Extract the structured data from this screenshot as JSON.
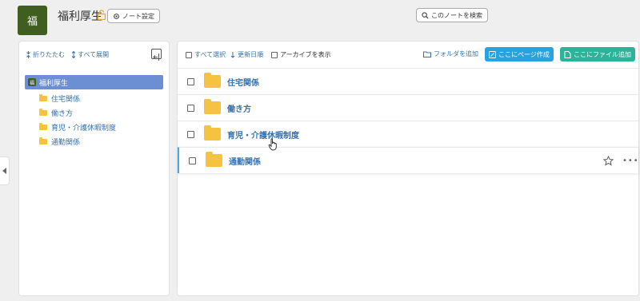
{
  "header": {
    "logo_text": "福",
    "title": "福利厚生",
    "settings_label": "ノート設定",
    "search_label": "このノートを検索"
  },
  "sidebar": {
    "collapse_label": "折りたたむ",
    "expand_label": "すべて展開",
    "root": {
      "logo": "福",
      "label": "福利厚生"
    },
    "items": [
      {
        "label": "住宅関係"
      },
      {
        "label": "働き方"
      },
      {
        "label": "育児・介護休暇制度"
      },
      {
        "label": "通勤関係"
      }
    ]
  },
  "main": {
    "select_all_label": "すべて選択",
    "sort_label": "更新日順",
    "show_archive_label": "アーカイブを表示",
    "add_folder_label": "フォルダを追加",
    "create_page_label": "ここにページ作成",
    "add_file_label": "ここにファイル追加",
    "rows": [
      {
        "label": "住宅関係"
      },
      {
        "label": "働き方"
      },
      {
        "label": "育児・介護休暇制度"
      },
      {
        "label": "通勤関係"
      }
    ]
  },
  "colors": {
    "logo_bg": "#3f5e1f",
    "accent_blue": "#3572b0",
    "page_button": "#29a3e0",
    "file_button": "#2db39a",
    "folder": "#f5c242",
    "selected_tree": "#6b8fd2"
  }
}
